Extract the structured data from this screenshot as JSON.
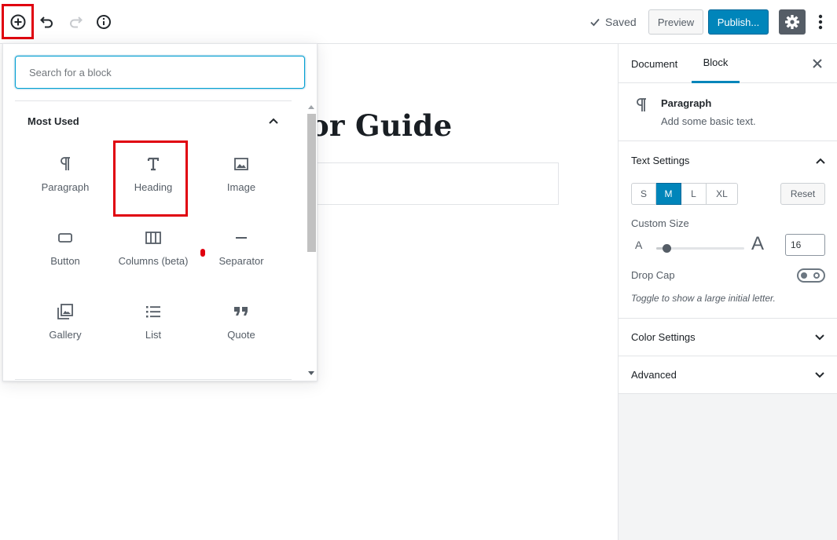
{
  "toolbar": {
    "saved_label": "Saved",
    "preview_label": "Preview",
    "publish_label": "Publish...",
    "colors": {
      "publish": "#0085ba",
      "settings": "#555d66",
      "highlight": "#e0000f"
    }
  },
  "editor": {
    "title_fragment": "or Guide"
  },
  "inserter": {
    "search_placeholder": "Search for a block",
    "section_title": "Most Used",
    "blocks": [
      {
        "label": "Paragraph",
        "icon": "paragraph-icon"
      },
      {
        "label": "Heading",
        "icon": "heading-icon"
      },
      {
        "label": "Image",
        "icon": "image-icon"
      },
      {
        "label": "Button",
        "icon": "button-icon"
      },
      {
        "label": "Columns (beta)",
        "icon": "columns-icon"
      },
      {
        "label": "Separator",
        "icon": "separator-icon"
      },
      {
        "label": "Gallery",
        "icon": "gallery-icon"
      },
      {
        "label": "List",
        "icon": "list-icon"
      },
      {
        "label": "Quote",
        "icon": "quote-icon"
      }
    ]
  },
  "sidebar": {
    "tabs": [
      {
        "label": "Document"
      },
      {
        "label": "Block"
      }
    ],
    "block_card": {
      "title": "Paragraph",
      "description": "Add some basic text."
    },
    "text_settings": {
      "title": "Text Settings",
      "sizes": [
        "S",
        "M",
        "L",
        "XL"
      ],
      "active_size": "M",
      "reset_label": "Reset",
      "custom_size_label": "Custom Size",
      "small_a": "A",
      "big_a": "A",
      "custom_size_value": "16",
      "slider_fraction": 0.12,
      "drop_cap_label": "Drop Cap",
      "drop_cap_help": "Toggle to show a large initial letter."
    },
    "color_settings_title": "Color Settings",
    "advanced_title": "Advanced"
  }
}
